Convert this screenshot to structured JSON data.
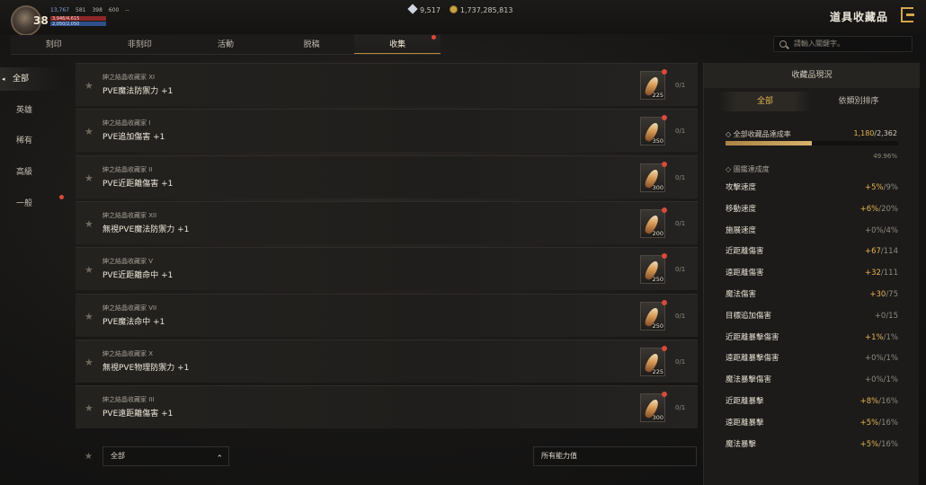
{
  "player": {
    "level": "38",
    "stats": [
      "13,767",
      "581",
      "398",
      "600",
      "--"
    ],
    "hp": "3,946/4,615",
    "mp": "2,050/2,050"
  },
  "currency": {
    "gems": "9,517",
    "gold": "1,737,285,813"
  },
  "header": {
    "title": "道具收藏品"
  },
  "tabs": [
    {
      "label": "刻印"
    },
    {
      "label": "非刻印"
    },
    {
      "label": "活動"
    },
    {
      "label": "脱稿"
    },
    {
      "label": "收集"
    }
  ],
  "search": {
    "placeholder": "請輸入關鍵字。"
  },
  "sidebar": {
    "items": [
      {
        "label": "全部"
      },
      {
        "label": "英雄"
      },
      {
        "label": "稀有"
      },
      {
        "label": "高級"
      },
      {
        "label": "一般"
      }
    ]
  },
  "items": [
    {
      "sub": "紳之結晶收藏家 XI",
      "title": "PVE魔法防禦力 +1",
      "qty": "225",
      "count": "0/1"
    },
    {
      "sub": "紳之結晶收藏家 I",
      "title": "PVE追加傷害 +1",
      "qty": "350",
      "count": "0/1"
    },
    {
      "sub": "紳之結晶收藏家 II",
      "title": "PVE近距離傷害 +1",
      "qty": "300",
      "count": "0/1"
    },
    {
      "sub": "紳之結晶收藏家 XII",
      "title": "無視PVE魔法防禦力 +1",
      "qty": "200",
      "count": "0/1"
    },
    {
      "sub": "紳之結晶收藏家 V",
      "title": "PVE近距離命中 +1",
      "qty": "250",
      "count": "0/1"
    },
    {
      "sub": "紳之結晶收藏家 VII",
      "title": "PVE魔法命中 +1",
      "qty": "250",
      "count": "0/1"
    },
    {
      "sub": "紳之結晶收藏家 X",
      "title": "無視PVE物理防禦力 +1",
      "qty": "225",
      "count": "0/1"
    },
    {
      "sub": "紳之結晶收藏家 III",
      "title": "PVE遠距離傷害 +1",
      "qty": "300",
      "count": "0/1"
    }
  ],
  "filters": {
    "grade": "全部",
    "ability": "所有能力值"
  },
  "panel": {
    "title": "收藏品現況",
    "tabs": [
      {
        "label": "全部"
      },
      {
        "label": "依類別排序"
      }
    ],
    "rate_label": "◇ 全部收藏品達成率",
    "rate_current": "1,180",
    "rate_total": "/2,362",
    "rate_fraction": 0.4996,
    "rate_percent": "49.96%",
    "category_label": "◇ 圖鑑達成度",
    "stats": [
      {
        "name": "攻擊速度",
        "value": "+5%",
        "max": "/9%",
        "active": true
      },
      {
        "name": "移動速度",
        "value": "+6%",
        "max": "/20%",
        "active": true
      },
      {
        "name": "施展速度",
        "value": "+0%",
        "max": "/4%",
        "active": false
      },
      {
        "name": "近距離傷害",
        "value": "+67",
        "max": "/114",
        "active": true
      },
      {
        "name": "遠距離傷害",
        "value": "+32",
        "max": "/111",
        "active": true
      },
      {
        "name": "魔法傷害",
        "value": "+30",
        "max": "/75",
        "active": true
      },
      {
        "name": "目標追加傷害",
        "value": "+0",
        "max": "/15",
        "active": false
      },
      {
        "name": "近距離暴擊傷害",
        "value": "+1%",
        "max": "/1%",
        "active": true
      },
      {
        "name": "遠距離暴擊傷害",
        "value": "+0%",
        "max": "/1%",
        "active": false
      },
      {
        "name": "魔法暴擊傷害",
        "value": "+0%",
        "max": "/1%",
        "active": false
      },
      {
        "name": "近距離暴擊",
        "value": "+8%",
        "max": "/16%",
        "active": true
      },
      {
        "name": "遠距離暴擊",
        "value": "+5%",
        "max": "/16%",
        "active": true
      },
      {
        "name": "魔法暴擊",
        "value": "+5%",
        "max": "/16%",
        "active": true
      }
    ]
  },
  "colors": {
    "accent": "#e8b34e",
    "alert": "#d94a3a"
  }
}
